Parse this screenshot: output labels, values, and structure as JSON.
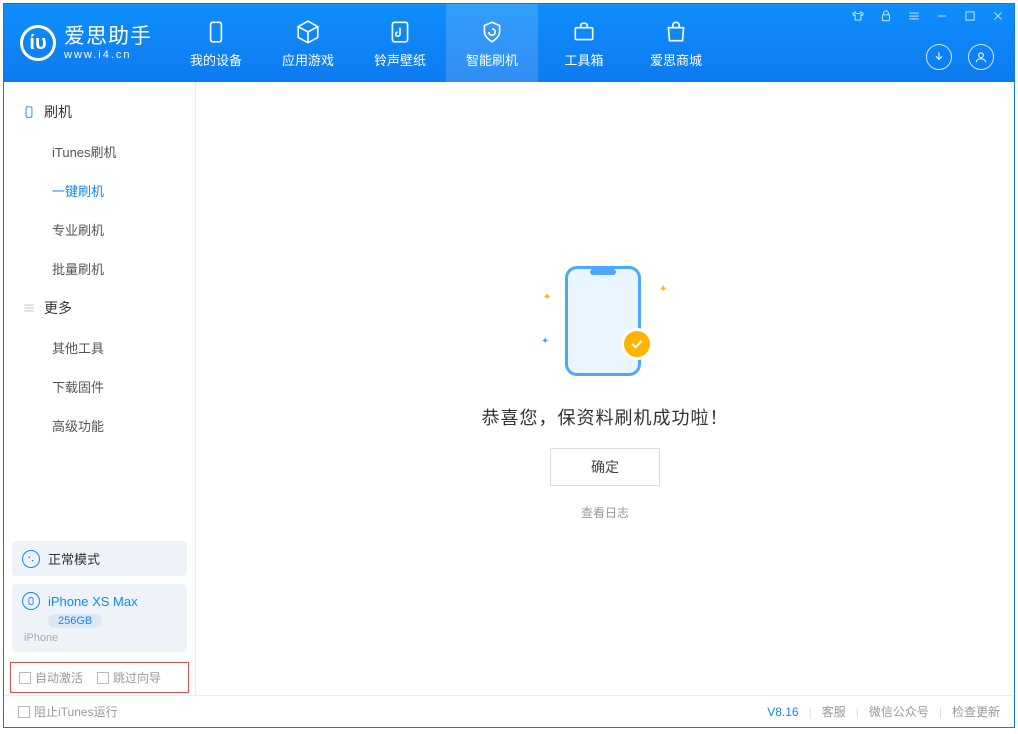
{
  "app": {
    "title": "爱思助手",
    "subtitle": "www.i4.cn"
  },
  "tabs": {
    "device": "我的设备",
    "apps": "应用游戏",
    "ring": "铃声壁纸",
    "flash": "智能刷机",
    "tools": "工具箱",
    "store": "爱思商城"
  },
  "sidebar": {
    "group1_title": "刷机",
    "items1": {
      "itunes": "iTunes刷机",
      "oneclick": "一键刷机",
      "pro": "专业刷机",
      "batch": "批量刷机"
    },
    "group2_title": "更多",
    "items2": {
      "other": "其他工具",
      "firmware": "下载固件",
      "advanced": "高级功能"
    },
    "mode_label": "正常模式",
    "device_name": "iPhone XS Max",
    "device_capacity": "256GB",
    "device_type": "iPhone",
    "opt_auto_activate": "自动激活",
    "opt_skip_wizard": "跳过向导"
  },
  "main": {
    "message": "恭喜您，保资料刷机成功啦！",
    "ok_label": "确定",
    "log_link": "查看日志"
  },
  "footer": {
    "block_itunes": "阻止iTunes运行",
    "version": "V8.16",
    "service": "客服",
    "wechat": "微信公众号",
    "update": "检查更新"
  }
}
